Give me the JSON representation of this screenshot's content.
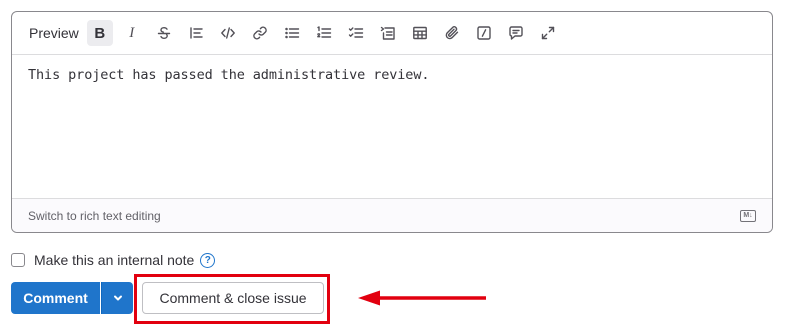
{
  "toolbar": {
    "preview_label": "Preview",
    "bold_glyph": "B",
    "italic_glyph": "I",
    "buttons": [
      {
        "name": "bold-button",
        "icon": "bold-icon"
      },
      {
        "name": "italic-button",
        "icon": "italic-icon"
      },
      {
        "name": "strikethrough-button",
        "icon": "strikethrough-icon"
      },
      {
        "name": "quote-button",
        "icon": "quote-icon"
      },
      {
        "name": "code-button",
        "icon": "code-icon"
      },
      {
        "name": "link-button",
        "icon": "link-icon"
      },
      {
        "name": "bullet-list-button",
        "icon": "bullet-list-icon"
      },
      {
        "name": "numbered-list-button",
        "icon": "numbered-list-icon"
      },
      {
        "name": "task-list-button",
        "icon": "task-list-icon"
      },
      {
        "name": "collapsible-button",
        "icon": "collapsible-section-icon"
      },
      {
        "name": "table-button",
        "icon": "table-icon"
      },
      {
        "name": "attach-file-button",
        "icon": "paperclip-icon"
      },
      {
        "name": "quick-actions-button",
        "icon": "slash-command-icon"
      },
      {
        "name": "comment-template-button",
        "icon": "comment-template-icon"
      },
      {
        "name": "fullscreen-button",
        "icon": "expand-icon"
      }
    ]
  },
  "editor": {
    "text": "This project has passed the administrative review.",
    "switch_label": "Switch to rich text editing",
    "markdown_badge": "M↓"
  },
  "internal_note": {
    "label": "Make this an internal note",
    "checked": false,
    "help_glyph": "?"
  },
  "actions": {
    "comment_label": "Comment",
    "close_label": "Comment & close issue"
  },
  "colors": {
    "primary": "#1f75cb",
    "highlight": "#e2000f"
  }
}
